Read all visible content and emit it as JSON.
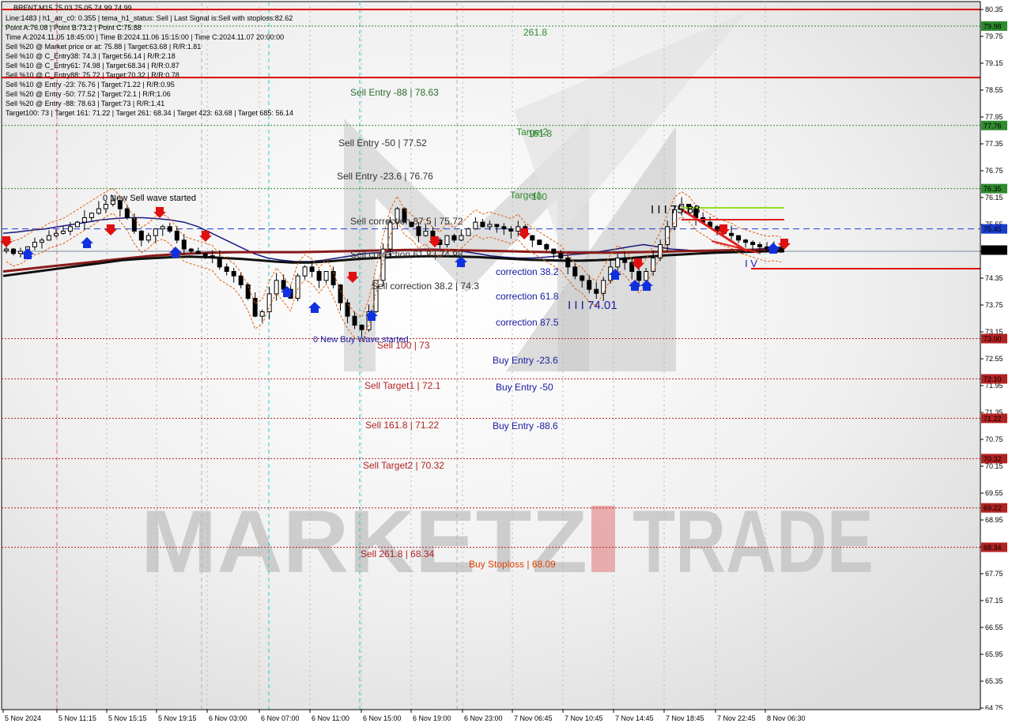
{
  "window": {
    "symbol_title": "BRENT,M15  75.03 75.05 74.99 74.99"
  },
  "watermark": {
    "text_left": "MARKETZ",
    "text_right": "TRADE",
    "accent_char": "I"
  },
  "info_panel": {
    "lines": [
      "Line:1483  |  h1_atr_c0: 0.355  |  tema_h1_status: Sell  |  Last Signal is:Sell with stoploss:82.62",
      "Point A:76.08  |  Point B:73.2  |  Point C:75.88",
      "Time A:2024.11.05 18:45:00  |  Time B:2024.11.06 15:15:00  |  Time C:2024.11.07 20:00:00",
      "Sell %20 @ Market price or at: 75.88  |  Target:63.68  |  R/R:1.81",
      "Sell %10 @ C_Entry38: 74.3  |  Target:56.14  |  R/R:2.18",
      "Sell %10 @ C_Entry61: 74.98  |  Target:68.34  |  R/R:0.87",
      "Sell %10 @ C_Entry88: 75.72  |  Target:70.32  |  R/R:0.78",
      "Sell %10 @ Entry -23: 76.76  |  Target:71.22  |  R/R:0.95",
      "Sell %20 @ Entry -50: 77.52  |  Target:72.1  |  R/R:1.06",
      "Sell %20 @ Entry -88: 78.63  |  Target:73  |  R/R:1.41",
      "Target100: 73  |  Target 161: 71.22  |  Target 261: 68.34  |  Target 423: 63.68  |  Target 685: 56.14"
    ]
  },
  "chart_data": {
    "type": "candlestick",
    "symbol": "BRENT",
    "timeframe": "M15",
    "ylim": [
      64.75,
      80.6
    ],
    "price_ticks": [
      "80.35",
      "79.75",
      "79.15",
      "78.55",
      "77.95",
      "77.35",
      "76.75",
      "76.15",
      "75.55",
      "74.95",
      "74.35",
      "73.75",
      "73.15",
      "72.55",
      "71.95",
      "71.35",
      "70.75",
      "70.15",
      "69.55",
      "68.95",
      "68.35",
      "67.75",
      "67.15",
      "66.55",
      "65.95",
      "65.35",
      "64.75"
    ],
    "time_labels": [
      "5 Nov 2024",
      "5 Nov 11:15",
      "5 Nov 15:15",
      "5 Nov 19:15",
      "6 Nov 03:00",
      "6 Nov 07:00",
      "6 Nov 11:00",
      "6 Nov 15:00",
      "6 Nov 19:00",
      "6 Nov 23:00",
      "7 Nov 06:45",
      "7 Nov 10:45",
      "7 Nov 14:45",
      "7 Nov 18:45",
      "7 Nov 22:45",
      "8 Nov 06:30"
    ],
    "current_price": "74.99",
    "horizontal_levels": [
      {
        "price": 80.35,
        "label": "",
        "style": "solid",
        "color": "#e00000"
      },
      {
        "price": 79.98,
        "label": "261.8",
        "badge": "79.98",
        "style": "dotted",
        "color": "#2e8b2e"
      },
      {
        "price": 78.83,
        "label": "",
        "style": "solid",
        "color": "#e00000"
      },
      {
        "price": 77.76,
        "label": "Target2",
        "badge": "77.76",
        "style": "dotted",
        "color": "#2e8b2e"
      },
      {
        "price": 76.35,
        "label": "Target1",
        "badge": "76.35",
        "style": "dotted",
        "color": "#2e8b2e"
      },
      {
        "price": 75.45,
        "label": "",
        "badge": "75.45",
        "style": "dashed",
        "color": "#1a3ccf"
      },
      {
        "price": 73.0,
        "label": "Sell 100 | 73",
        "badge": "73.00",
        "style": "dotted",
        "color": "#b22222"
      },
      {
        "price": 72.1,
        "label": "Sell Target1 | 72.1",
        "badge": "72.10",
        "style": "dotted",
        "color": "#b22222"
      },
      {
        "price": 71.22,
        "label": "Sell 161.8 | 71.22",
        "badge": "71.22",
        "style": "dotted",
        "color": "#b22222"
      },
      {
        "price": 70.32,
        "label": "Sell Target2 | 70.32",
        "badge": "70.32",
        "style": "dotted",
        "color": "#b22222"
      },
      {
        "price": 69.22,
        "label": "",
        "badge": "69.22",
        "style": "dotted",
        "color": "#b22222"
      },
      {
        "price": 68.34,
        "label": "Sell 261.8 | 68.34",
        "badge": "68.34",
        "style": "dotted",
        "color": "#b22222"
      }
    ],
    "level_labels": [
      {
        "text": "Sell Entry -88 | 78.63",
        "color": "#2e6b2e"
      },
      {
        "text": "Sell Entry -50 | 77.52",
        "color": "#333333"
      },
      {
        "text": "Sell Entry -23.6 | 76.76",
        "color": "#333333"
      },
      {
        "text": "Sell correction 87.5 | 75.72",
        "color": "#333333"
      },
      {
        "text": "Sell correction 61.8 | 74.98",
        "color": "#333333"
      },
      {
        "text": "Sell correction 38.2 | 74.3",
        "color": "#333333"
      },
      {
        "text": "correction 38.2",
        "color": "#1a1aa0"
      },
      {
        "text": "correction 61.8",
        "color": "#1a1aa0"
      },
      {
        "text": "correction 87.5",
        "color": "#1a1aa0"
      },
      {
        "text": "Buy Entry -23.6",
        "color": "#1a1aa0"
      },
      {
        "text": "Buy Entry -50",
        "color": "#1a1aa0"
      },
      {
        "text": "Buy Entry -88.6",
        "color": "#1a1aa0"
      },
      {
        "text": "Buy Stoploss | 68.09",
        "color": "#e04000"
      },
      {
        "text": "Target1",
        "color": "#2e8b2e"
      },
      {
        "text": "100",
        "color": "#2e8b2e"
      },
      {
        "text": "Target2",
        "color": "#2e8b2e"
      },
      {
        "text": "161.8",
        "color": "#2e8b2e"
      }
    ],
    "wave_labels": [
      {
        "text": "0 New Sell wave started",
        "color": "#000000"
      },
      {
        "text": "0 New Buy Wave started",
        "color": "#1a1aa0"
      },
      {
        "text": "I I I 74.01",
        "color": "#1a1aa0"
      },
      {
        "text": "I I I 75.88",
        "color": "#000000"
      },
      {
        "text": "I V",
        "color": "#1a1aa0"
      }
    ],
    "close_path": [
      75.0,
      74.9,
      74.95,
      75.05,
      75.15,
      75.2,
      75.3,
      75.35,
      75.4,
      75.5,
      75.6,
      75.7,
      75.8,
      75.9,
      76.0,
      76.08,
      75.9,
      75.7,
      75.4,
      75.2,
      75.3,
      75.45,
      75.5,
      75.4,
      75.2,
      75.0,
      74.95,
      74.9,
      74.85,
      74.8,
      74.6,
      74.5,
      74.4,
      74.2,
      73.9,
      73.5,
      73.6,
      74.0,
      74.3,
      74.1,
      73.9,
      74.4,
      74.6,
      74.5,
      74.3,
      74.5,
      74.2,
      73.8,
      73.5,
      73.3,
      73.2,
      73.6,
      74.3,
      75.0,
      75.6,
      75.9,
      75.6,
      75.5,
      75.3,
      75.4,
      75.2,
      75.1,
      75.3,
      75.2,
      75.3,
      75.45,
      75.6,
      75.5,
      75.55,
      75.5,
      75.45,
      75.4,
      75.5,
      75.3,
      75.2,
      75.1,
      75.0,
      74.9,
      74.8,
      74.6,
      74.4,
      74.3,
      74.1,
      74.01,
      74.3,
      74.6,
      74.8,
      74.7,
      74.5,
      74.3,
      74.5,
      74.8,
      75.1,
      75.5,
      75.88,
      76.0,
      75.9,
      75.7,
      75.6,
      75.5,
      75.4,
      75.35,
      75.3,
      75.2,
      75.15,
      75.1,
      75.05,
      75.0,
      75.02,
      74.99
    ],
    "ma_series": [
      {
        "name": "",
        "color": "#1a1a80",
        "values": [
          75.35,
          75.38,
          75.42,
          75.45,
          75.5,
          75.55,
          75.6,
          75.65,
          75.68,
          75.7,
          75.7,
          75.68,
          75.65,
          75.6,
          75.5,
          75.35,
          75.2,
          75.05,
          74.9,
          74.8,
          74.75,
          74.72,
          74.72,
          74.75,
          74.8,
          74.85,
          74.9,
          74.92,
          74.95,
          74.98,
          75.0,
          75.0,
          74.98,
          74.95,
          74.9,
          74.85,
          74.82,
          74.8,
          74.8,
          74.82,
          74.85,
          74.88,
          74.9,
          74.95,
          75.0,
          75.05,
          75.1,
          75.05,
          75.0,
          74.98,
          74.95,
          74.95,
          74.95,
          74.98,
          75.0,
          75.02,
          75.05
        ]
      },
      {
        "name": "",
        "color": "#101010",
        "values": [
          74.4,
          74.45,
          74.5,
          74.55,
          74.6,
          74.65,
          74.7,
          74.75,
          74.78,
          74.8,
          74.82,
          74.83,
          74.82,
          74.8,
          74.78,
          74.75,
          74.72,
          74.7,
          74.7,
          74.72,
          74.75,
          74.78,
          74.8,
          74.82,
          74.83,
          74.84,
          74.84,
          74.83,
          74.82,
          74.8,
          74.78,
          74.76,
          74.75,
          74.74,
          74.74,
          74.75,
          74.77,
          74.8,
          74.83,
          74.86,
          74.88,
          74.9,
          74.92,
          74.93,
          74.94,
          74.95,
          74.95
        ]
      },
      {
        "name": "",
        "color": "#8b1a1a",
        "values": [
          74.5,
          74.55,
          74.6,
          74.65,
          74.7,
          74.75,
          74.8,
          74.85,
          74.88,
          74.9,
          74.92,
          74.93,
          74.93,
          74.93,
          74.93,
          74.94,
          74.95,
          74.96,
          74.97,
          74.98,
          74.98,
          74.98,
          74.97,
          74.96,
          74.95,
          74.94,
          74.93,
          74.92,
          74.92,
          74.92,
          74.93,
          74.94,
          74.95,
          74.96,
          74.97,
          74.98,
          74.98,
          74.98
        ]
      }
    ]
  }
}
